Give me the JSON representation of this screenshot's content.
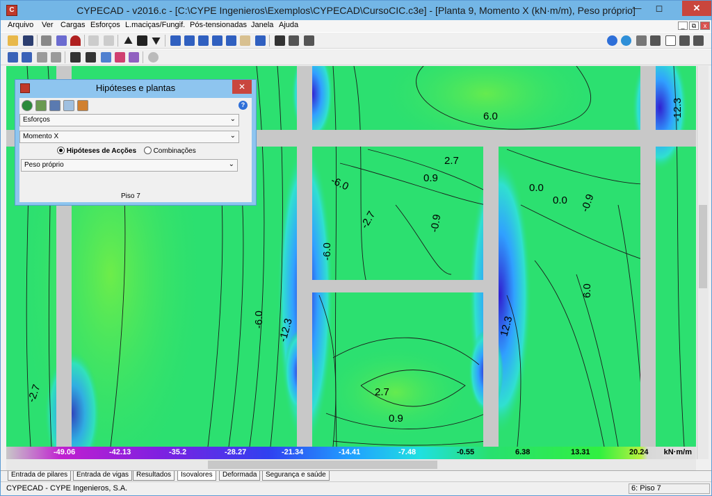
{
  "window": {
    "title": "CYPECAD - v2016.c - [C:\\CYPE Ingenieros\\Exemplos\\CYPECAD\\CursoCIC.c3e] - [Planta 9, Momento X (kN·m/m), Peso próprio]"
  },
  "menu": [
    "Arquivo",
    "Ver",
    "Cargas",
    "Esforços",
    "L.maciças/Fungif.",
    "Pós-tensionadas",
    "Janela",
    "Ajuda"
  ],
  "contour_labels": [
    "6.0",
    "2.7",
    "0.9",
    "0.0",
    "-0.9",
    "-2.7",
    "-6.0",
    "-12.3",
    "6.0",
    "12.3",
    "-6.0",
    "0.9",
    "2.7",
    "-2.7",
    "0.0",
    "-0.9",
    "-6.0",
    "-12.3"
  ],
  "legend": {
    "values": [
      "-49.06",
      "-42.13",
      "-35.2",
      "-28.27",
      "-21.34",
      "-14.41",
      "-7.48",
      "-0.55",
      "6.38",
      "13.31",
      "20.24"
    ],
    "unit": "kN·m/m"
  },
  "panel": {
    "title": "Hipóteses e plantas",
    "select1": "Esforços",
    "select2": "Momento X",
    "radio1": "Hipóteses de Acções",
    "radio2": "Combinações",
    "select3": "Peso próprio",
    "floor": "Piso 7"
  },
  "tabs": [
    "Entrada de pilares",
    "Entrada de vigas",
    "Resultados",
    "Isovalores",
    "Deformada",
    "Segurança e saúde"
  ],
  "status": {
    "left": "CYPECAD - CYPE Ingenieros, S.A.",
    "right": "6: Piso 7"
  },
  "colors": {
    "titlebar": "#73b6e6",
    "plot_green": "#28e070",
    "beam_gray": "#c8c8c8",
    "close_red": "#c9463d"
  }
}
